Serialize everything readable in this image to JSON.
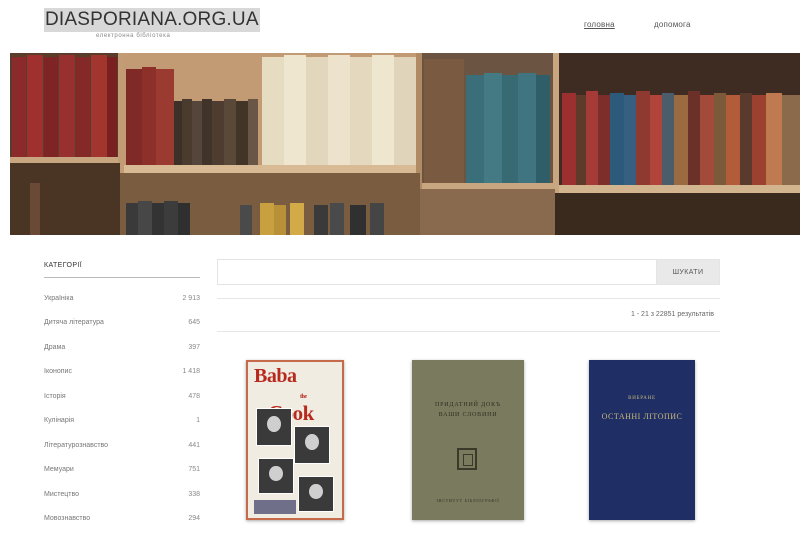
{
  "site": {
    "title": "DIASPORIANA.ORG.UA",
    "subtitle": "електронна бібліотека"
  },
  "nav": {
    "home_label": "головна",
    "help_label": "допомога"
  },
  "banner": {
    "icon": "bookshelf-image"
  },
  "sidebar": {
    "heading": "КАТЕГОРІЇ",
    "items": [
      {
        "label": "Україніка",
        "count": "2 913"
      },
      {
        "label": "Дитяча література",
        "count": "645"
      },
      {
        "label": "Драма",
        "count": "397"
      },
      {
        "label": "Іконопис",
        "count": "1 418"
      },
      {
        "label": "Історія",
        "count": "478"
      },
      {
        "label": "Кулінарія",
        "count": "1"
      },
      {
        "label": "Літературознавство",
        "count": "441"
      },
      {
        "label": "Мемуари",
        "count": "751"
      },
      {
        "label": "Мистецтво",
        "count": "338"
      },
      {
        "label": "Мовознавство",
        "count": "294"
      }
    ]
  },
  "search": {
    "placeholder": "",
    "button_label": "ШУКАТИ"
  },
  "results": {
    "summary": "1 - 21 з 22851 результатів"
  },
  "books": [
    {
      "cover_title_line1": "Baba",
      "cover_title_line2": "Cook",
      "cover_small": "the"
    },
    {
      "cover_line1": "ПРИДАТНИЙ ДОКЪ",
      "cover_line2": "ВАШИ СЛОВИНИ",
      "cover_footer": "ІНСТИТУТ БІБЛІОГРАФІЇ"
    },
    {
      "cover_small": "ВИБРАНЕ",
      "cover_title": "ОСТАННІ ЛІТОПИС"
    }
  ],
  "colors": {
    "accent_red": "#b62a1e",
    "book2_bg": "#7a7a5e",
    "book3_bg": "#1f2f66"
  }
}
